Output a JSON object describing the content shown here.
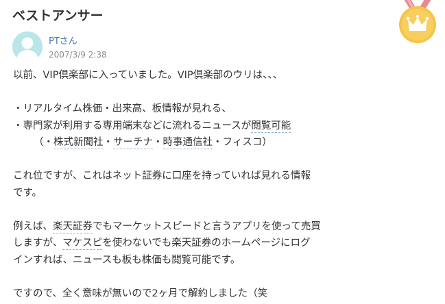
{
  "header": {
    "title": "ベストアンサー"
  },
  "author": {
    "name": "PTさん",
    "date": "2007/3/9 2:38"
  },
  "answer": {
    "l1": "以前、VIP倶楽部に入っていました。VIP倶楽部のウリは、、、",
    "l2": "・リアルタイム株価・出来高、板情報が見れる、",
    "l3a": "・専門家が利用する専用端末などに流れるニュースが",
    "l3b": "閲覧可能",
    "l4a": "（・",
    "l4b": "株式新聞社",
    "l4c": "・",
    "l4d": "サーチナ",
    "l4e": "・",
    "l4f": "時事通信社",
    "l4g": "・フィスコ）",
    "l5": "これ位ですが、これはネット証券に口座を持っていれば見れる情報",
    "l6": "です。",
    "l7a": "例えば、",
    "l7b": "楽天証券",
    "l7c": "でもマーケットスピードと言うアプリを使って売買",
    "l8a": "しますが、",
    "l8b": "マケスピ",
    "l8c": "を使わないでも楽天証券のホームページにログ",
    "l9": "インすれば、ニュースも板も株価も閲覧可能です。",
    "l10": "ですので、全く意味が無いので2ヶ月で解約しました（笑"
  },
  "icons": {
    "medal": "crown-medal-icon",
    "avatar": "default-user-avatar"
  },
  "colors": {
    "link": "#3d7ab8",
    "medal_gold": "#f5c54a",
    "ribbon": "#e58a92",
    "avatar_bg": "#b9e6e7"
  }
}
